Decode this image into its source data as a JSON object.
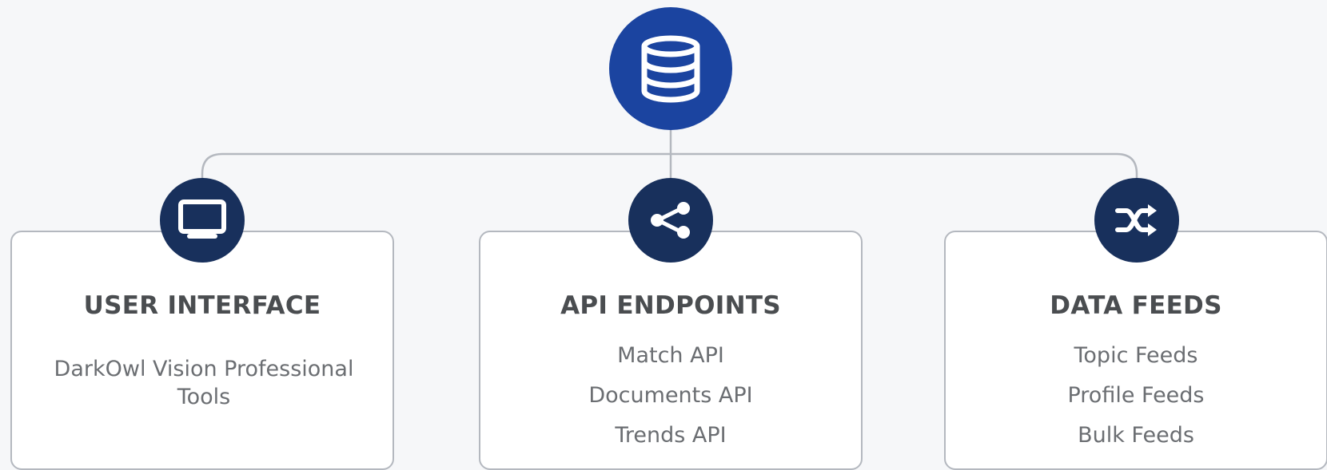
{
  "diagram": {
    "root": {
      "icon": "database-icon",
      "color": "#1b44a0"
    },
    "branches": [
      {
        "icon": "monitor-icon",
        "title": "USER INTERFACE",
        "description": "DarkOwl Vision Professional Tools"
      },
      {
        "icon": "share-icon",
        "title": "API ENDPOINTS",
        "items": [
          "Match API",
          "Documents API",
          "Trends API"
        ]
      },
      {
        "icon": "shuffle-icon",
        "title": "DATA FEEDS",
        "items": [
          "Topic Feeds",
          "Profile Feeds",
          "Bulk Feeds"
        ]
      }
    ],
    "colors": {
      "root_fill": "#1b44a0",
      "branch_icon_fill": "#18305c",
      "connector": "#b4b8bf",
      "title_text": "#4a4d50",
      "body_text": "#6b6e72"
    }
  }
}
